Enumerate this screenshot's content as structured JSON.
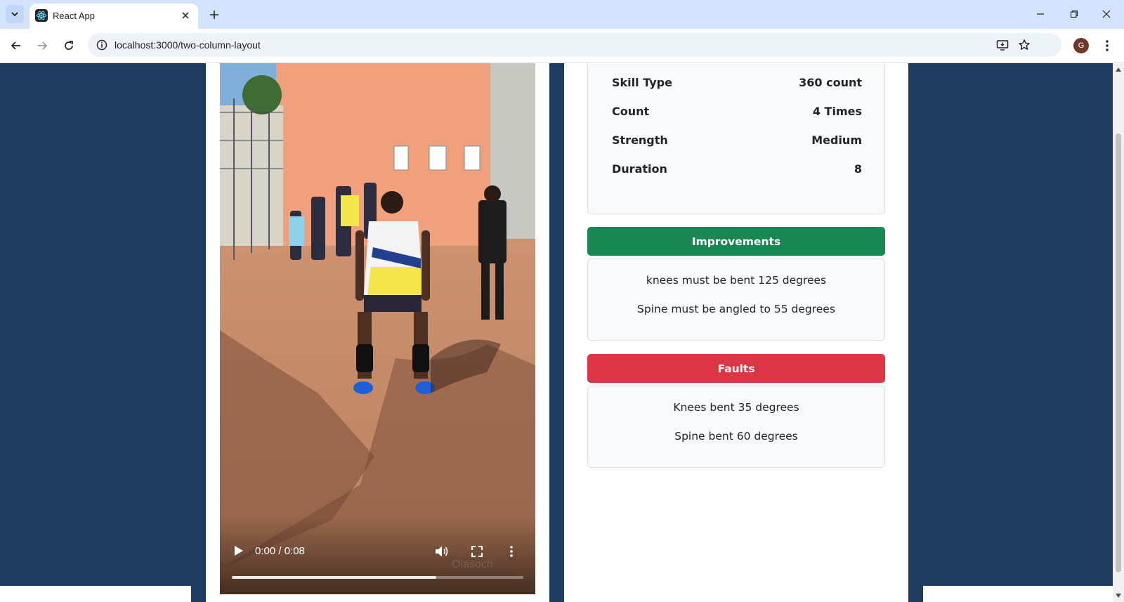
{
  "browser": {
    "tab_title": "React App",
    "url": "localhost:3000/two-column-layout",
    "profile_initial": "G"
  },
  "video": {
    "time_display": "0:00 / 0:08",
    "progress_fraction": 0.7
  },
  "stats": [
    {
      "label": "Skill Type",
      "value": "360 count"
    },
    {
      "label": "Count",
      "value": "4 Times"
    },
    {
      "label": "Strength",
      "value": "Medium"
    },
    {
      "label": "Duration",
      "value": "8"
    }
  ],
  "improvements": {
    "title": "Improvements",
    "color": "#198754",
    "items": [
      "knees must be bent 125 degrees",
      "Spine must be angled to 55 degrees"
    ]
  },
  "faults": {
    "title": "Faults",
    "color": "#dc3545",
    "items": [
      "Knees bent 35 degrees",
      "Spine bent 60 degrees"
    ]
  },
  "theme": {
    "page_background": "#1e3a5f",
    "panel_background": "#ffffff"
  }
}
